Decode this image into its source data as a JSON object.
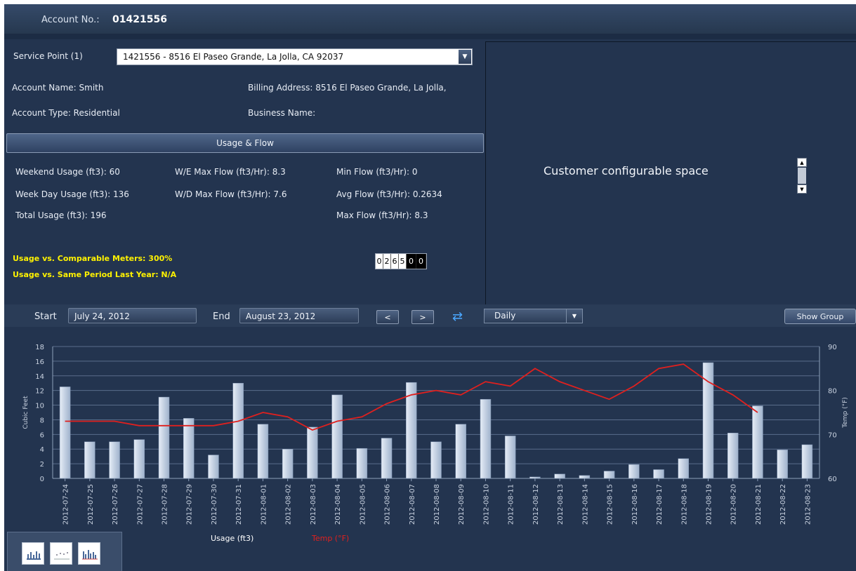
{
  "header": {
    "account_label": "Account No.:",
    "account_value": "01421556"
  },
  "service": {
    "label": "Service Point (1)",
    "selected": "1421556 - 8516 El Paseo Grande, La Jolla, CA 92037"
  },
  "account": {
    "name": "Account Name:  Smith",
    "type": "Account Type:  Residential",
    "billing": "Billing Address:  8516 El Paseo Grande, La Jolla,",
    "business": "Business Name:"
  },
  "usage_flow": {
    "title": "Usage & Flow",
    "weekend": "Weekend Usage (ft3): 60",
    "weekday": "Week Day Usage (ft3): 136",
    "total": "Total Usage (ft3): 196",
    "we_max": "W/E Max Flow (ft3/Hr): 8.3",
    "wd_max": "W/D Max Flow (ft3/Hr): 7.6",
    "min_flow": "Min Flow (ft3/Hr): 0",
    "avg_flow": "Avg Flow (ft3/Hr): 0.2634",
    "max_flow": "Max Flow (ft3/Hr): 8.3"
  },
  "comparisons": {
    "comparable": "Usage vs. Comparable Meters: 300%",
    "last_year": "Usage vs. Same Period Last Year: N/A"
  },
  "meter_reading": {
    "white_digits": [
      "0",
      "2",
      "6",
      "5"
    ],
    "black_digits": [
      "0",
      "0"
    ]
  },
  "config_panel": {
    "text": "Customer configurable space"
  },
  "controls": {
    "start_label": "Start",
    "start_value": "July 24, 2012",
    "end_label": "End",
    "end_value": "August 23, 2012",
    "prev": "<",
    "next": ">",
    "interval": "Daily",
    "show_group": "Show Group"
  },
  "chart_data": {
    "type": "bar",
    "ylabel": "Cubic Feet",
    "y2label": "Temp (°F)",
    "ylim": [
      0,
      18
    ],
    "y2lim": [
      60,
      90
    ],
    "yticks": [
      0,
      2,
      4,
      6,
      8,
      10,
      12,
      14,
      16,
      18
    ],
    "y2ticks": [
      60,
      70,
      80,
      90
    ],
    "grid": true,
    "categories": [
      "2012-07-24",
      "2012-07-25",
      "2012-07-26",
      "2012-07-27",
      "2012-07-28",
      "2012-07-29",
      "2012-07-30",
      "2012-07-31",
      "2012-08-01",
      "2012-08-02",
      "2012-08-03",
      "2012-08-04",
      "2012-08-05",
      "2012-08-06",
      "2012-08-07",
      "2012-08-08",
      "2012-08-09",
      "2012-08-10",
      "2012-08-11",
      "2012-08-12",
      "2012-08-13",
      "2012-08-14",
      "2012-08-15",
      "2012-08-16",
      "2012-08-17",
      "2012-08-18",
      "2012-08-19",
      "2012-08-20",
      "2012-08-21",
      "2012-08-22",
      "2012-08-23"
    ],
    "series": [
      {
        "name": "Usage (ft3)",
        "type": "bar",
        "color": "#c4d0e2",
        "values": [
          12.5,
          5,
          5,
          5.3,
          11.1,
          8.2,
          3.2,
          13,
          7.4,
          4,
          7,
          11.4,
          4.1,
          5.5,
          13.1,
          5,
          7.4,
          10.8,
          5.8,
          0.2,
          0.6,
          0.4,
          1,
          1.9,
          1.2,
          2.7,
          15.8,
          6.2,
          9.9,
          3.9,
          4.6
        ]
      },
      {
        "name": "Temp (°F)",
        "type": "line",
        "axis": "right",
        "color": "#e0201e",
        "values": [
          73,
          73,
          73,
          72,
          72,
          72,
          72,
          73,
          75,
          74,
          71,
          73,
          74,
          77,
          79,
          80,
          79,
          82,
          81,
          85,
          82,
          80,
          78,
          81,
          85,
          86,
          82,
          79,
          75,
          null,
          null
        ]
      }
    ]
  },
  "legend": {
    "usage": "Usage (ft3)",
    "temp": "Temp (°F)"
  },
  "chart_tabs": [
    "bar-chart-icon",
    "scatter-chart-icon",
    "multi-bar-chart-icon"
  ]
}
